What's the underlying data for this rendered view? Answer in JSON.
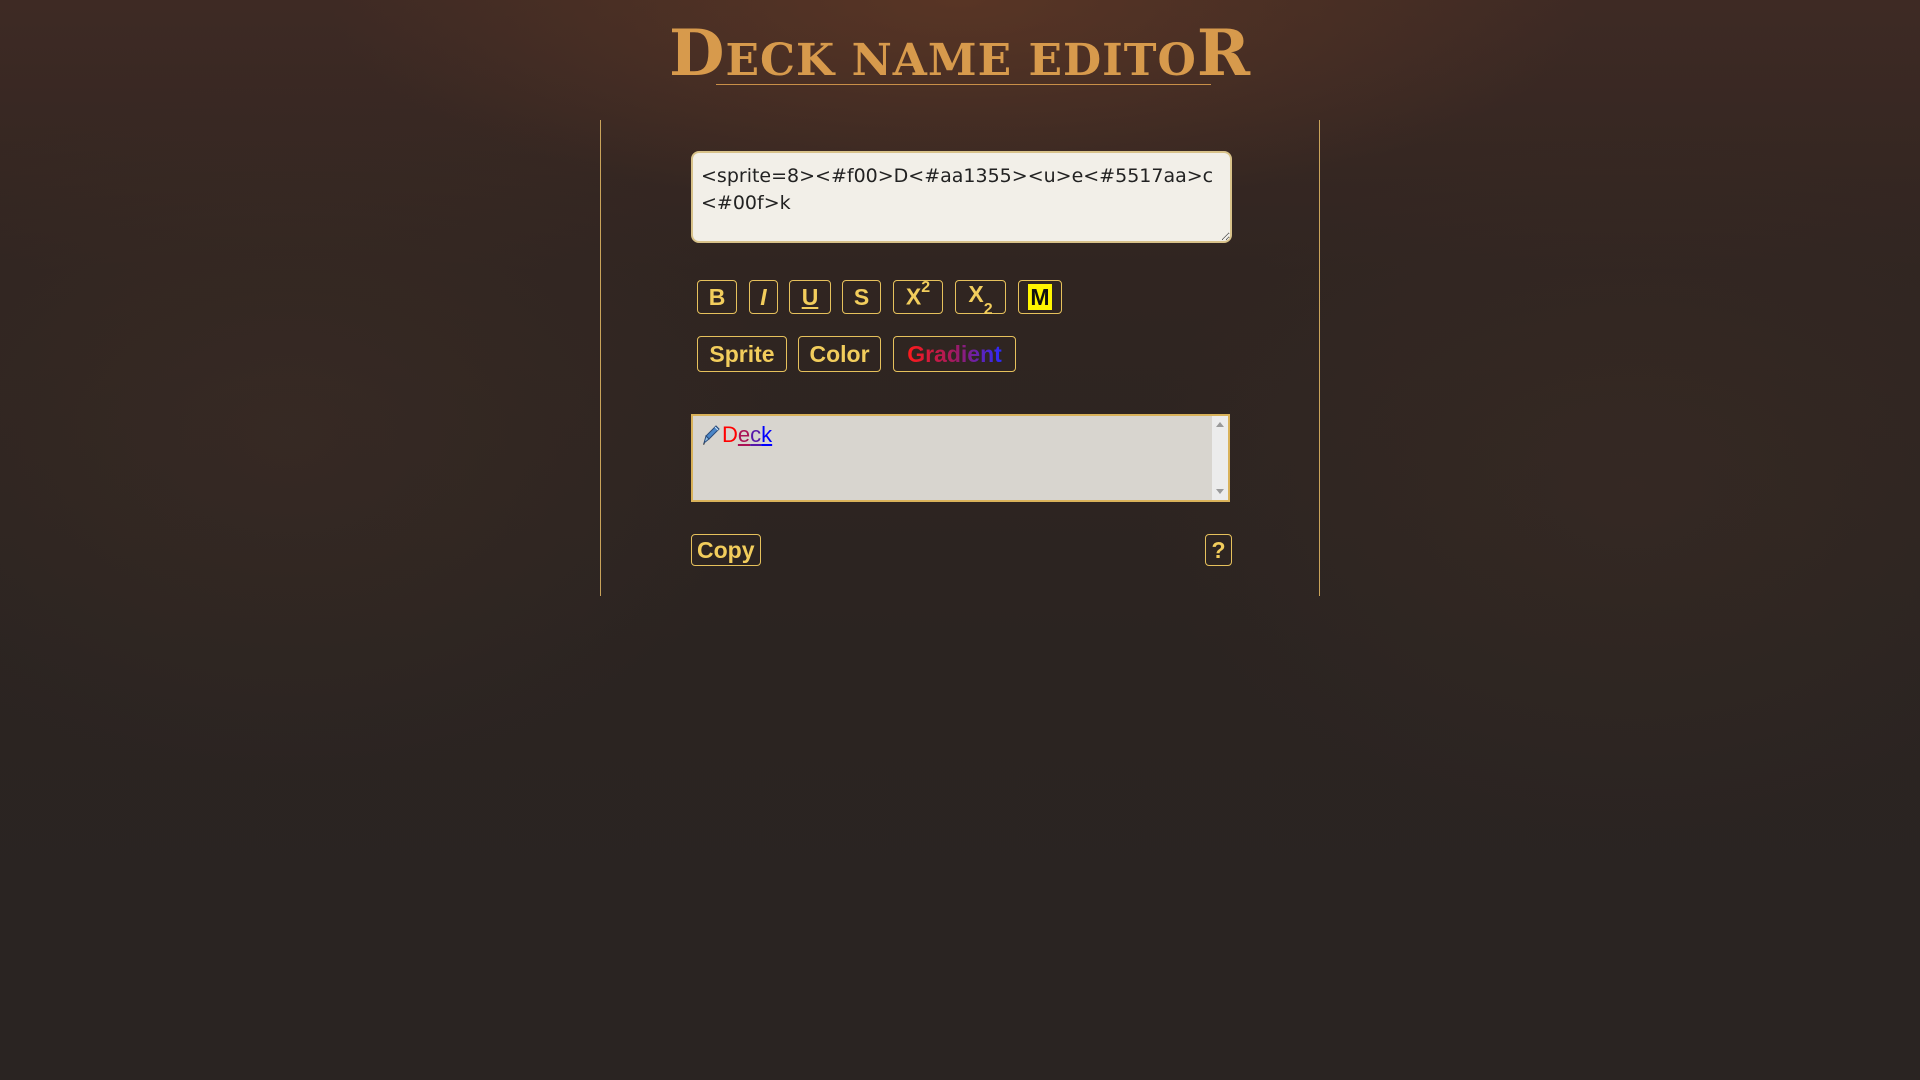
{
  "title": {
    "first_letter": "D",
    "middle": "ECK NAME EDITO",
    "last_letter": "R",
    "color": "#d79a4c"
  },
  "source_input": {
    "value": "<sprite=8><#f00>D<#aa1355><u>e<#5517aa>c<#00f>k"
  },
  "format_toolbar": {
    "bold_label": "B",
    "italic_label": "I",
    "underline_label": "U",
    "strikethrough_label": "S",
    "superscript_base": "X",
    "superscript_exp": "2",
    "subscript_base": "X",
    "subscript_sub": "2",
    "mark_label": "M"
  },
  "insert_toolbar": {
    "sprite_label": "Sprite",
    "color_label": "Color",
    "gradient_label": "Gradient"
  },
  "preview": {
    "sprite_icon": "pen-sprite-icon",
    "letters": [
      {
        "char": "D",
        "color": "#ff0000",
        "underline": false
      },
      {
        "char": "e",
        "color": "#aa1355",
        "underline": true
      },
      {
        "char": "c",
        "color": "#5517aa",
        "underline": true
      },
      {
        "char": "k",
        "color": "#0000ff",
        "underline": true
      }
    ]
  },
  "actions": {
    "copy_label": "Copy",
    "help_label": "?"
  },
  "colors": {
    "accent": "#f2cd5c",
    "border": "#e6c15c",
    "panel_border": "#c9a35a"
  }
}
